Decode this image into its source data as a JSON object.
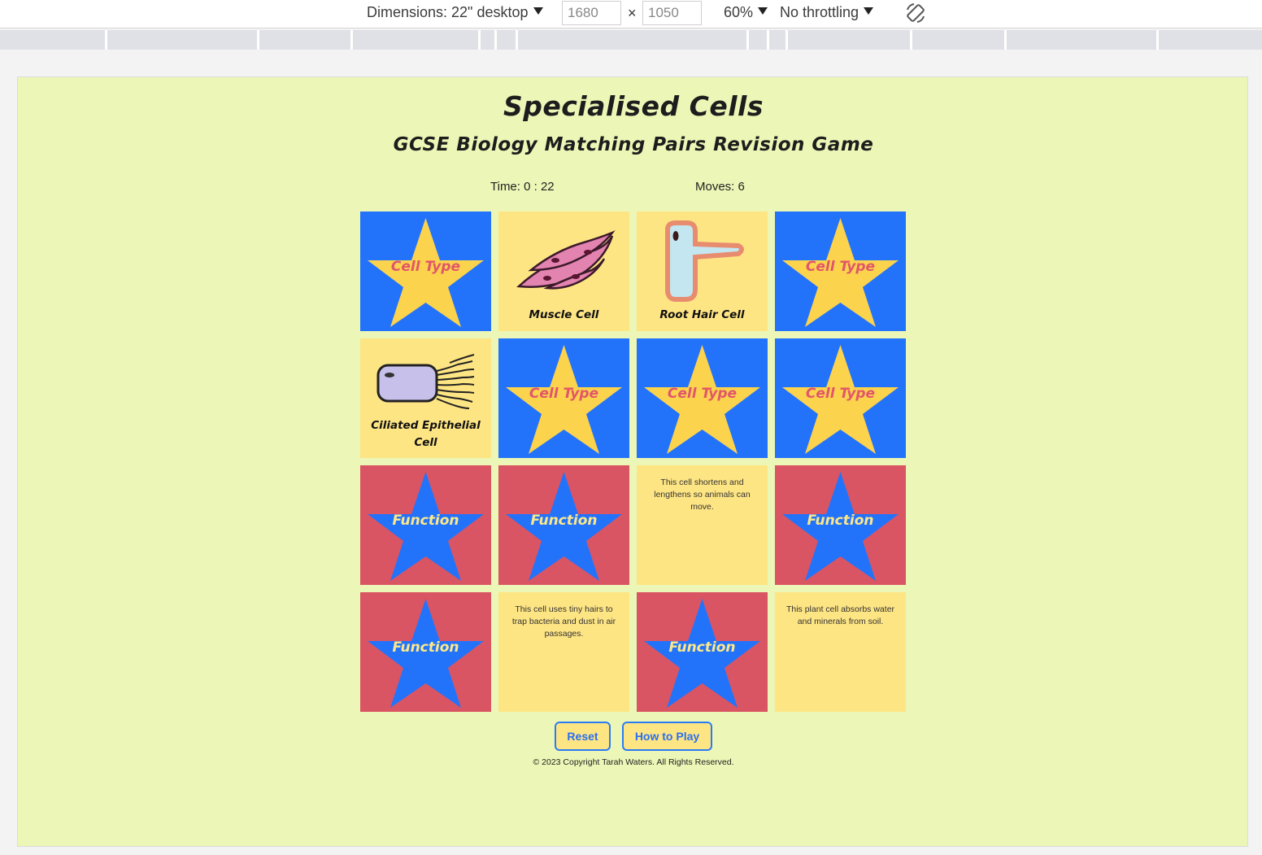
{
  "devtools": {
    "dimensions_label": "Dimensions: 22\" desktop",
    "width_value": "1680",
    "height_value": "1050",
    "times_sign": "×",
    "zoom": "60%",
    "throttling": "No throttling",
    "rotate_icon": "rotate-icon"
  },
  "game": {
    "title": "Specialised Cells",
    "subtitle": "GCSE Biology Matching Pairs Revision Game",
    "time_text": "Time: 0 : 22",
    "moves_text": "Moves: 6",
    "back_labels": {
      "cell_type": "Cell Type",
      "function": "Function"
    },
    "cards": {
      "r1c1": "Cell Type",
      "r1c2": "Muscle Cell",
      "r1c3": "Root Hair Cell",
      "r1c4": "Cell Type",
      "r2c1": "Ciliated Epithelial Cell",
      "r2c2": "Cell Type",
      "r2c3": "Cell Type",
      "r2c4": "Cell Type",
      "r3c1": "Function",
      "r3c2": "Function",
      "r3c3": "This cell shortens and lengthens so animals can move.",
      "r3c4": "Function",
      "r4c1": "Function",
      "r4c2": "This cell uses tiny hairs to trap bacteria and dust in air passages.",
      "r4c3": "Function",
      "r4c4": "This plant cell absorbs water and minerals from soil."
    },
    "buttons": {
      "reset": "Reset",
      "how_to_play": "How to Play"
    },
    "copyright": "© 2023 Copyright Tarah Waters. All Rights Reserved."
  },
  "colors": {
    "page_bg": "#ecf6b6",
    "cell_type_back": "#2373fa",
    "function_back": "#da5563",
    "open_card": "#fee584",
    "star_yellow": "#fcd34d",
    "star_blue": "#2373fa"
  }
}
